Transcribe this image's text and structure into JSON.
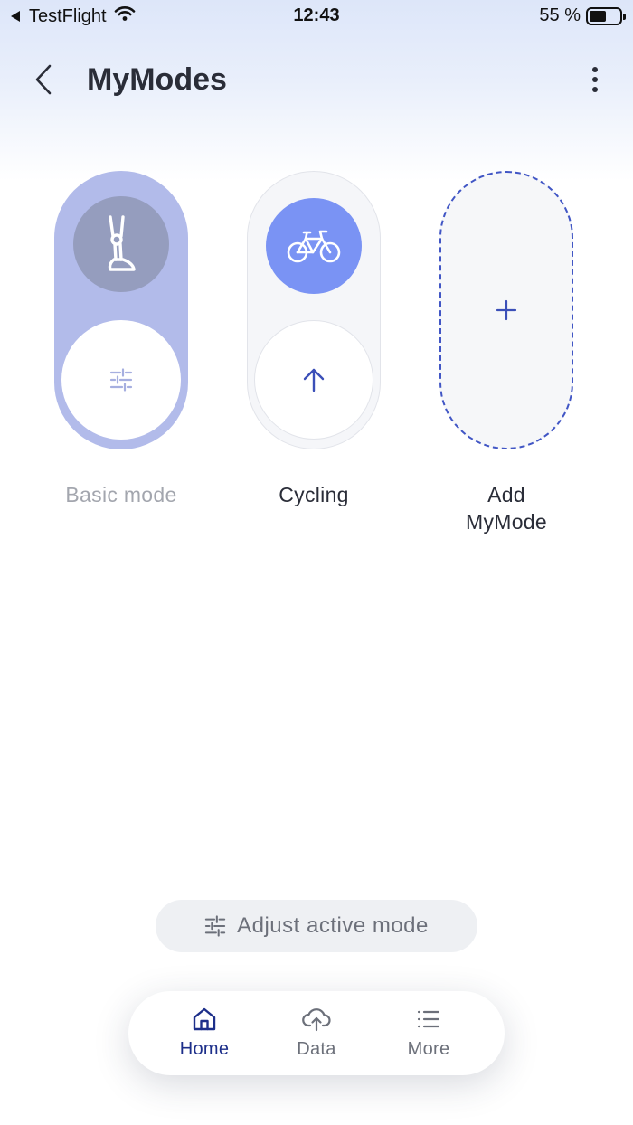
{
  "status_bar": {
    "carrier": "TestFlight",
    "time": "12:43",
    "battery_text": "55 %",
    "battery_level": 0.55
  },
  "header": {
    "title": "MyModes",
    "back_icon": "chevron-left-icon",
    "menu_icon": "more-vertical-icon"
  },
  "modes": [
    {
      "label": "Basic mode",
      "icon": "prosthetic-leg-icon",
      "action_icon": "sliders-icon",
      "active": true
    },
    {
      "label": "Cycling",
      "icon": "bicycle-icon",
      "action_icon": "arrow-up-icon",
      "active": false
    },
    {
      "label": "Add MyMode",
      "icon": "plus-icon"
    }
  ],
  "adjust_button": {
    "label": "Adjust active mode",
    "icon": "sliders-icon"
  },
  "tab_bar": {
    "tabs": [
      {
        "label": "Home",
        "icon": "home-icon",
        "selected": true
      },
      {
        "label": "Data",
        "icon": "cloud-upload-icon",
        "selected": false
      },
      {
        "label": "More",
        "icon": "list-icon",
        "selected": false
      }
    ]
  },
  "colors": {
    "accent": "#4156c5",
    "active_card": "#b2bbea",
    "cycling_icon_bg": "#7a93f4",
    "tab_selected": "#1d2f8a"
  }
}
